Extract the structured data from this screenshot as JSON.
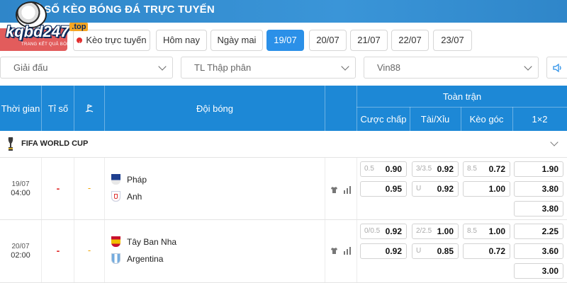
{
  "header": {
    "title": "TỈ SỐ KÈO BÓNG ĐÁ TRỰC TUYẾN",
    "logo_text": "kqbd247",
    "logo_suffix": ".top",
    "logo_tagline": "TRANG KẾT QUẢ BÓNG ĐÁ"
  },
  "date_filter": {
    "live_label": "Kèo trực tuyến",
    "today_label": "Hôm nay",
    "tomorrow_label": "Ngày mai",
    "dates": [
      "19/07",
      "20/07",
      "21/07",
      "22/07",
      "23/07"
    ],
    "active_date": "19/07"
  },
  "dropdowns": {
    "league": "Giải đấu",
    "odds_format": "TL Thập phân",
    "bookmaker": "Vin88"
  },
  "table_header": {
    "time": "Thời gian",
    "score": "Tỉ số",
    "teams": "Đội bóng",
    "full_match": "Toàn trận",
    "handicap": "Cược chấp",
    "over_under": "Tài/Xỉu",
    "corners": "Kèo góc",
    "one_x_two": "1×2"
  },
  "league": {
    "name": "FIFA WORLD CUP"
  },
  "matches": [
    {
      "date": "19/07",
      "time": "04:00",
      "score": "-",
      "corner_score": "-",
      "home": "Pháp",
      "away": "Anh",
      "handicap": {
        "line": "0.5",
        "home": "0.90",
        "away": "0.95"
      },
      "over_under": {
        "line": "3/3.5",
        "over": "0.92",
        "under_label": "U",
        "under": "0.92"
      },
      "corners": {
        "line": "8.5",
        "over": "0.72",
        "under": "1.00"
      },
      "one_x_two": [
        "1.90",
        "3.80",
        "3.80"
      ]
    },
    {
      "date": "20/07",
      "time": "02:00",
      "score": "-",
      "corner_score": "-",
      "home": "Tây Ban Nha",
      "away": "Argentina",
      "handicap": {
        "line": "0/0.5",
        "home": "0.92",
        "away": "0.92"
      },
      "over_under": {
        "line": "2/2.5",
        "over": "1.00",
        "under_label": "U",
        "under": "0.85"
      },
      "corners": {
        "line": "8.5",
        "over": "1.00",
        "under": "0.72"
      },
      "one_x_two": [
        "2.25",
        "3.60",
        "3.00"
      ]
    }
  ],
  "colors": {
    "header_blue": "#1d88d6",
    "active_date": "#2b90e8",
    "score_red": "#e02626",
    "corner_orange": "#f0a400"
  }
}
